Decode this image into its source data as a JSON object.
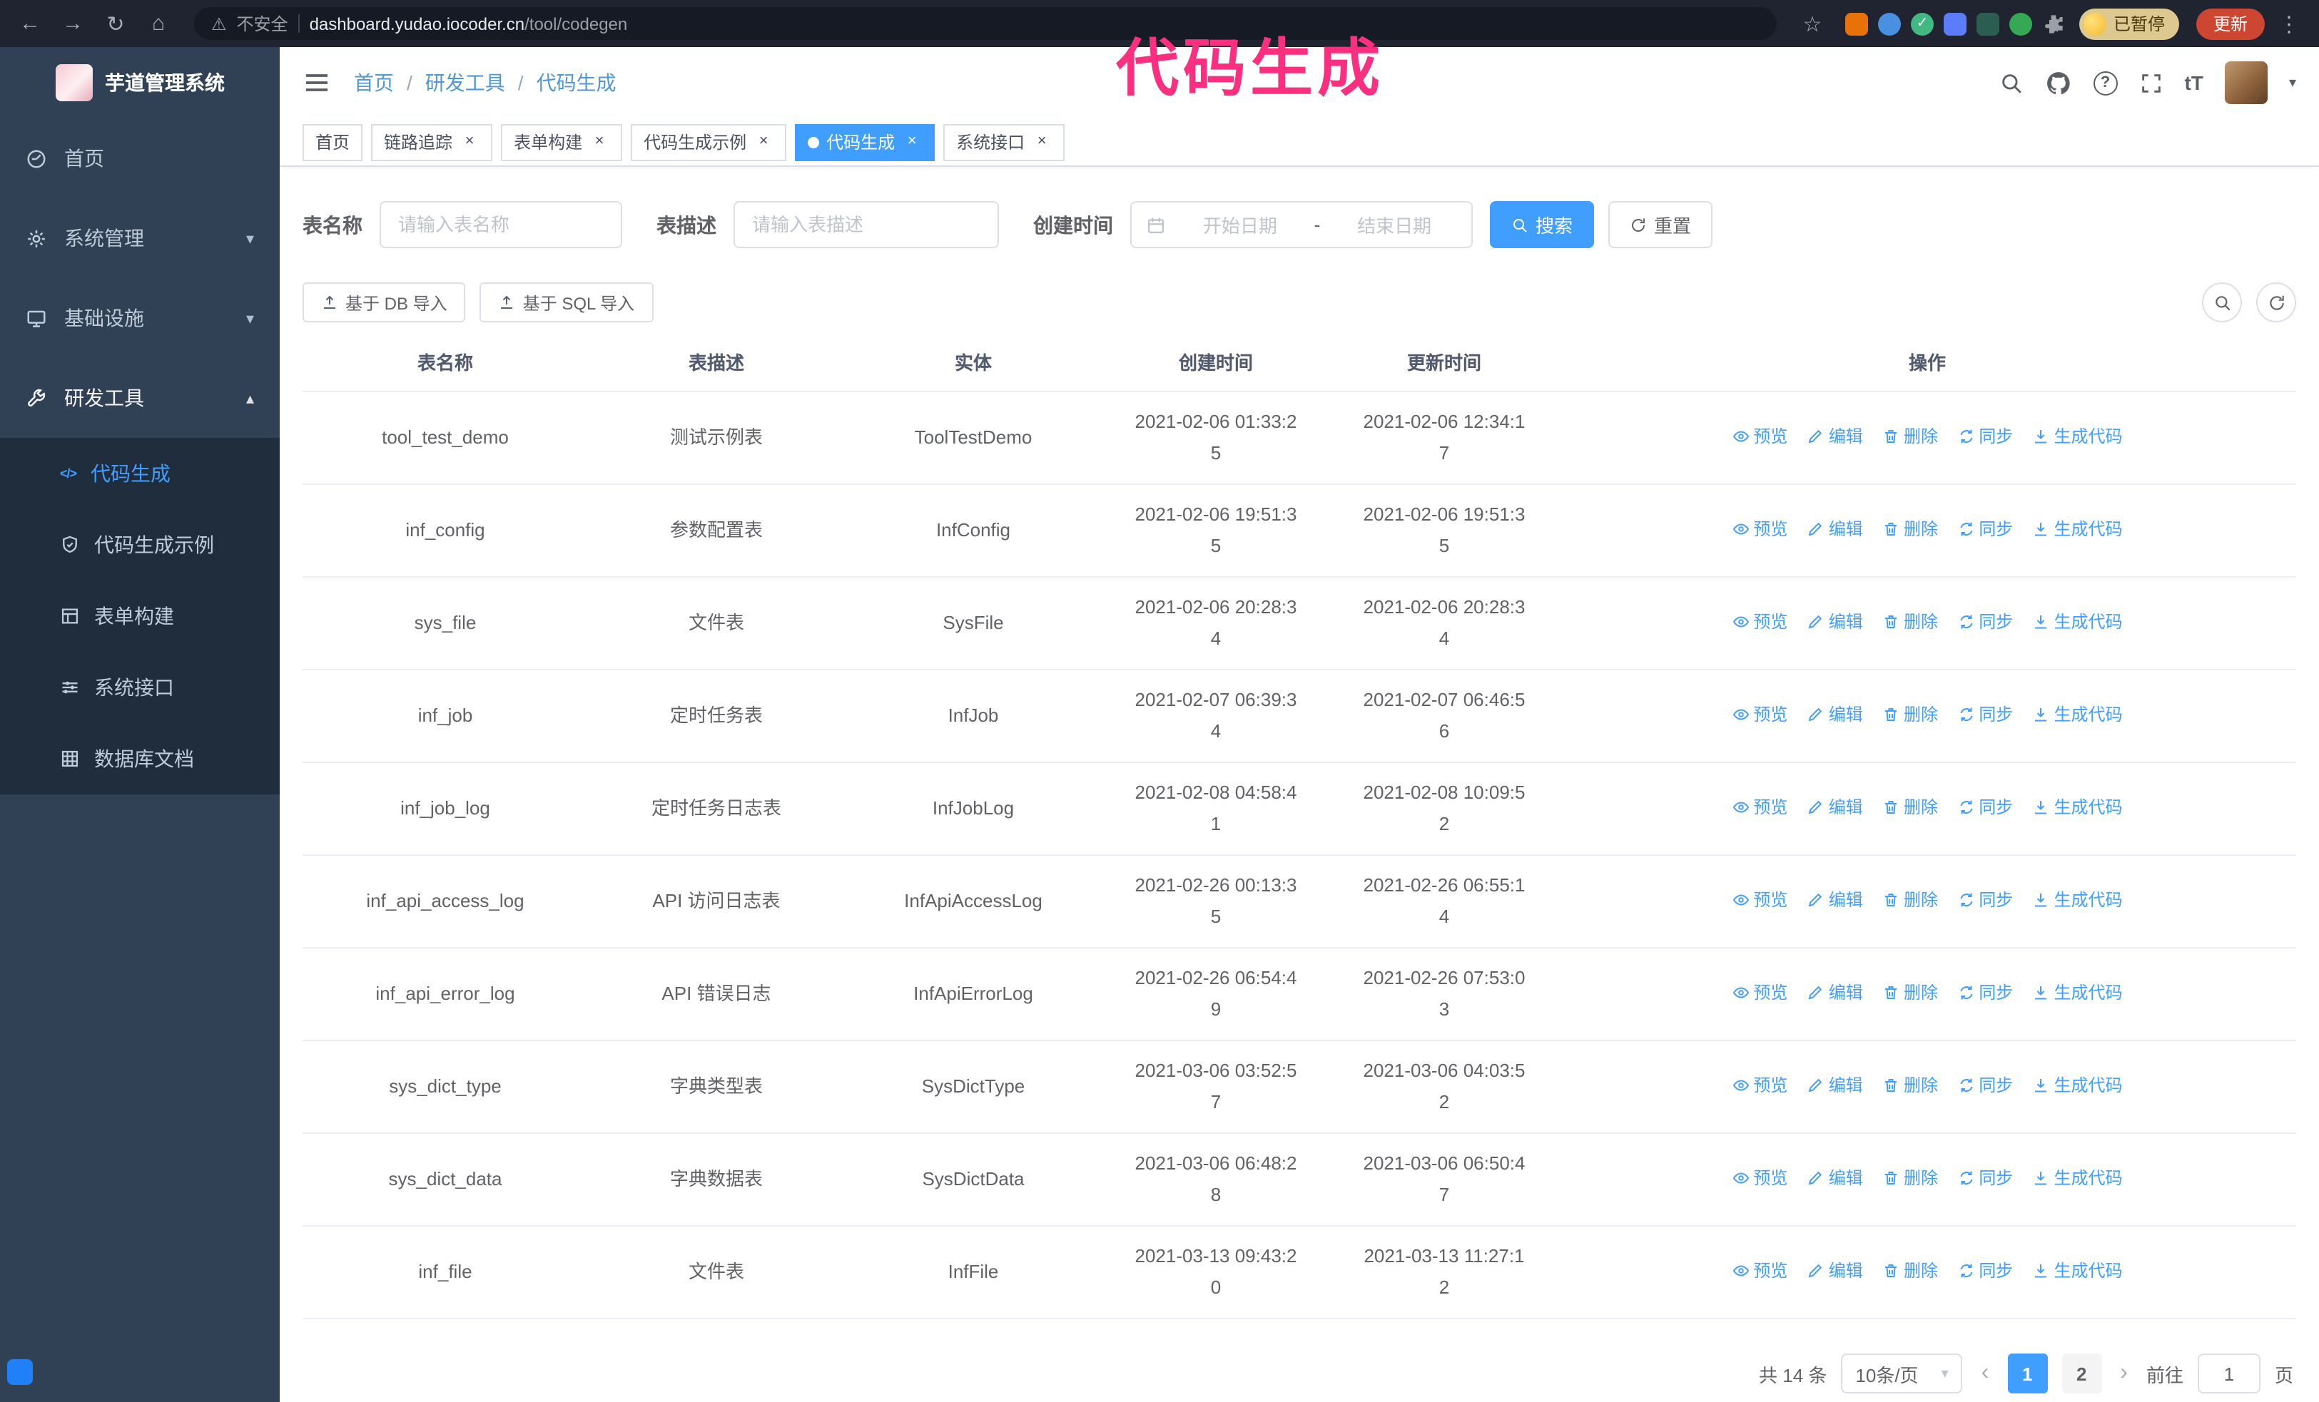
{
  "colors": {
    "accent": "#409eff",
    "sidebar_bg": "#304156",
    "submenu_bg": "#1f2d3d",
    "annotation": "#fb2f7f",
    "active_page_bg": "#409eff"
  },
  "browser": {
    "security_label": "不安全",
    "url_host": "dashboard.yudao.iocoder.cn",
    "url_path": "/tool/codegen",
    "paused_badge": "已暂停",
    "update_button": "更新"
  },
  "annotation_text": "代码生成",
  "icons": {
    "back": "←",
    "forward": "→",
    "reload": "↻",
    "home": "⌂",
    "warning": "⚠",
    "star": "☆",
    "menu_dots": "⋮",
    "check": "✓",
    "close": "×",
    "chevron_down": "▾",
    "chevron_up": "▴",
    "caret_down": "▾",
    "prev": "‹",
    "next": "›",
    "code": "</>",
    "question": "?",
    "text_size": "tT"
  },
  "sidebar": {
    "logo_title": "芋道管理系统",
    "items": [
      {
        "label": "首页"
      },
      {
        "label": "系统管理"
      },
      {
        "label": "基础设施"
      },
      {
        "label": "研发工具"
      }
    ],
    "subitems": [
      {
        "label": "代码生成"
      },
      {
        "label": "代码生成示例"
      },
      {
        "label": "表单构建"
      },
      {
        "label": "系统接口"
      },
      {
        "label": "数据库文档"
      }
    ]
  },
  "breadcrumb": {
    "items": [
      "首页",
      "研发工具",
      "代码生成"
    ],
    "separator": "/"
  },
  "tabs": [
    {
      "label": "首页"
    },
    {
      "label": "链路追踪"
    },
    {
      "label": "表单构建"
    },
    {
      "label": "代码生成示例"
    },
    {
      "label": "代码生成"
    },
    {
      "label": "系统接口"
    }
  ],
  "filters": {
    "name_label": "表名称",
    "name_placeholder": "请输入表名称",
    "desc_label": "表描述",
    "desc_placeholder": "请输入表描述",
    "time_label": "创建时间",
    "start_placeholder": "开始日期",
    "range_separator": "-",
    "end_placeholder": "结束日期",
    "search": "搜索",
    "reset": "重置"
  },
  "toolbar": {
    "import_db": "基于 DB 导入",
    "import_sql": "基于 SQL 导入"
  },
  "table": {
    "columns": [
      "表名称",
      "表描述",
      "实体",
      "创建时间",
      "更新时间",
      "操作"
    ],
    "actions": [
      "预览",
      "编辑",
      "删除",
      "同步",
      "生成代码"
    ],
    "rows": [
      {
        "name": "tool_test_demo",
        "desc": "测试示例表",
        "entity": "ToolTestDemo",
        "created": "2021-02-06 01:33:25",
        "updated": "2021-02-06 12:34:17"
      },
      {
        "name": "inf_config",
        "desc": "参数配置表",
        "entity": "InfConfig",
        "created": "2021-02-06 19:51:35",
        "updated": "2021-02-06 19:51:35"
      },
      {
        "name": "sys_file",
        "desc": "文件表",
        "entity": "SysFile",
        "created": "2021-02-06 20:28:34",
        "updated": "2021-02-06 20:28:34"
      },
      {
        "name": "inf_job",
        "desc": "定时任务表",
        "entity": "InfJob",
        "created": "2021-02-07 06:39:34",
        "updated": "2021-02-07 06:46:56"
      },
      {
        "name": "inf_job_log",
        "desc": "定时任务日志表",
        "entity": "InfJobLog",
        "created": "2021-02-08 04:58:41",
        "updated": "2021-02-08 10:09:52"
      },
      {
        "name": "inf_api_access_log",
        "desc": "API 访问日志表",
        "entity": "InfApiAccessLog",
        "created": "2021-02-26 00:13:35",
        "updated": "2021-02-26 06:55:14"
      },
      {
        "name": "inf_api_error_log",
        "desc": "API 错误日志",
        "entity": "InfApiErrorLog",
        "created": "2021-02-26 06:54:49",
        "updated": "2021-02-26 07:53:03"
      },
      {
        "name": "sys_dict_type",
        "desc": "字典类型表",
        "entity": "SysDictType",
        "created": "2021-03-06 03:52:57",
        "updated": "2021-03-06 04:03:52"
      },
      {
        "name": "sys_dict_data",
        "desc": "字典数据表",
        "entity": "SysDictData",
        "created": "2021-03-06 06:48:28",
        "updated": "2021-03-06 06:50:47"
      },
      {
        "name": "inf_file",
        "desc": "文件表",
        "entity": "InfFile",
        "created": "2021-03-13 09:43:20",
        "updated": "2021-03-13 11:27:12"
      }
    ]
  },
  "pagination": {
    "total": "共 14 条",
    "page_size": "10条/页",
    "pages": [
      "1",
      "2"
    ],
    "goto_label": "前往",
    "goto_value": "1",
    "goto_unit": "页"
  }
}
